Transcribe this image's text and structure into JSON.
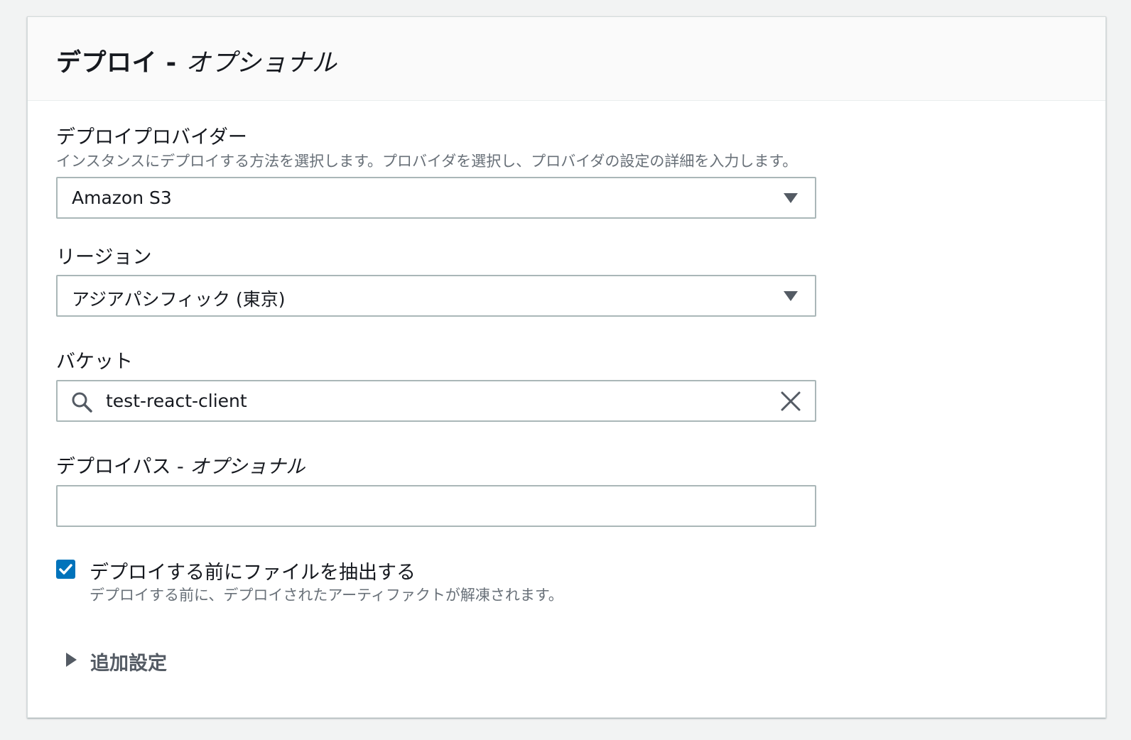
{
  "panel": {
    "title": "デプロイ - ",
    "title_optional": "オプショナル"
  },
  "provider": {
    "label": "デプロイプロバイダー",
    "description": "インスタンスにデプロイする方法を選択します。プロバイダを選択し、プロバイダの設定の詳細を入力します。",
    "value": "Amazon S3"
  },
  "region": {
    "label": "リージョン",
    "value": "アジアパシフィック (東京)"
  },
  "bucket": {
    "label": "バケット",
    "value": "test-react-client"
  },
  "deploy_path": {
    "label": "デプロイパス - ",
    "label_optional": "オプショナル",
    "value": ""
  },
  "extract": {
    "label": "デプロイする前にファイルを抽出する",
    "description": "デプロイする前に、デプロイされたアーティファクトが解凍されます。",
    "checked": true
  },
  "additional": {
    "label": "追加設定"
  },
  "colors": {
    "accent": "#0073bb",
    "border": "#aab7b8",
    "muted_text": "#687078",
    "icon": "#545b64"
  }
}
